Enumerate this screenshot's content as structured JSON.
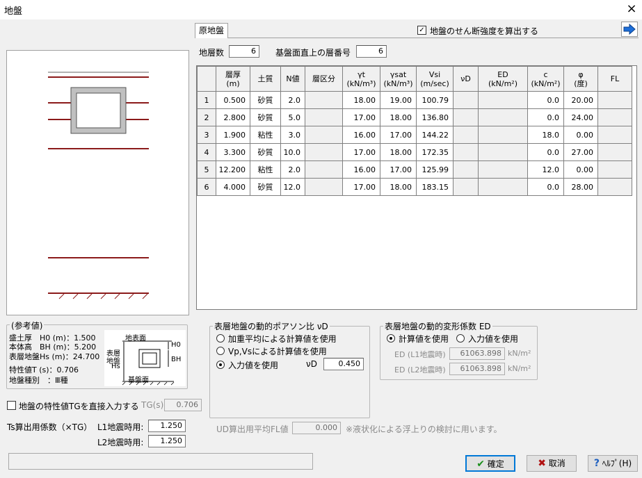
{
  "window": {
    "title": "地盤",
    "close_label": "×"
  },
  "tab": {
    "label": "原地盤"
  },
  "shear_check": {
    "checked": true,
    "label": "地盤のせん断強度を算出する"
  },
  "layers": {
    "count_label": "地層数",
    "count_value": "6",
    "base_label": "基盤面直上の層番号",
    "base_value": "6"
  },
  "table": {
    "headers": [
      "",
      "層厚\n(m)",
      "土質",
      "N値",
      "層区分",
      "γt\n(kN/m³)",
      "γsat\n(kN/m³)",
      "Vsi\n(m/sec)",
      "νD",
      "ED\n(kN/m²)",
      "c\n(kN/m²)",
      "φ\n(度)",
      "FL"
    ],
    "rows": [
      {
        "no": "1",
        "thick": "0.500",
        "soil": "砂質",
        "n": "2.0",
        "div": "",
        "gt": "18.00",
        "gsat": "19.00",
        "vsi": "100.79",
        "nu": "",
        "ed": "",
        "c": "0.0",
        "phi": "20.00",
        "fl": ""
      },
      {
        "no": "2",
        "thick": "2.800",
        "soil": "砂質",
        "n": "5.0",
        "div": "",
        "gt": "17.00",
        "gsat": "18.00",
        "vsi": "136.80",
        "nu": "",
        "ed": "",
        "c": "0.0",
        "phi": "24.00",
        "fl": ""
      },
      {
        "no": "3",
        "thick": "1.900",
        "soil": "粘性",
        "n": "3.0",
        "div": "",
        "gt": "16.00",
        "gsat": "17.00",
        "vsi": "144.22",
        "nu": "",
        "ed": "",
        "c": "18.0",
        "phi": "0.00",
        "fl": ""
      },
      {
        "no": "4",
        "thick": "3.300",
        "soil": "砂質",
        "n": "10.0",
        "div": "",
        "gt": "17.00",
        "gsat": "18.00",
        "vsi": "172.35",
        "nu": "",
        "ed": "",
        "c": "0.0",
        "phi": "27.00",
        "fl": ""
      },
      {
        "no": "5",
        "thick": "12.200",
        "soil": "粘性",
        "n": "2.0",
        "div": "",
        "gt": "16.00",
        "gsat": "17.00",
        "vsi": "125.99",
        "nu": "",
        "ed": "",
        "c": "12.0",
        "phi": "0.00",
        "fl": ""
      },
      {
        "no": "6",
        "thick": "4.000",
        "soil": "砂質",
        "n": "12.0",
        "div": "",
        "gt": "17.00",
        "gsat": "18.00",
        "vsi": "183.15",
        "nu": "",
        "ed": "",
        "c": "0.0",
        "phi": "28.00",
        "fl": ""
      }
    ]
  },
  "reference": {
    "title": "参考値",
    "l1": "盛土厚　H0 (m)：1.500",
    "l2": "本体高　BH (m)：5.200",
    "l3": "表層地盤Hs (m)：24.700",
    "l4": "特性値T (s)：0.706",
    "l5": "地盤種別　：Ⅲ種",
    "fig_surface": "地表面",
    "fig_base": "基盤面",
    "fig_h0": "H0",
    "fig_bh": "BH",
    "fig_hs1": "表層",
    "fig_hs2": "地盤",
    "fig_hs3": "Hs"
  },
  "tg": {
    "checked": false,
    "label": "地盤の特性値TGを直接入力する",
    "field_label": "TG(s)",
    "value": "0.706"
  },
  "ts": {
    "label": "Ts算出用係数（×TG）",
    "l1_label": "L1地震時用:",
    "l1_value": "1.250",
    "l2_label": "L2地震時用:",
    "l2_value": "1.250"
  },
  "poisson": {
    "title": "表層地盤の動的ポアソン比 νD",
    "opt1": "加重平均による計算値を使用",
    "opt2": "Vp,Vsによる計算値を使用",
    "opt3": "入力値を使用",
    "selected": 3,
    "value_label": "νD",
    "value": "0.450"
  },
  "deform": {
    "title": "表層地盤の動的変形係数 ED",
    "opt1": "計算値を使用",
    "opt2": "入力値を使用",
    "selected": 1,
    "l1_label": "ED (L1地震時)",
    "l1_value": "61063.898",
    "l2_label": "ED (L2地震時)",
    "l2_value": "61063.898",
    "unit": "kN/m²"
  },
  "ud": {
    "label": "UD算出用平均FL値",
    "value": "0.000",
    "note": "※液状化による浮上りの検討に用います。"
  },
  "buttons": {
    "ok": "確定",
    "cancel": "取消",
    "help": "ﾍﾙﾌﾟ(H)"
  },
  "colors": {
    "ground_line": "#8b1a1a",
    "accent": "#0078d7",
    "box_fill": "#c0c0c0"
  }
}
